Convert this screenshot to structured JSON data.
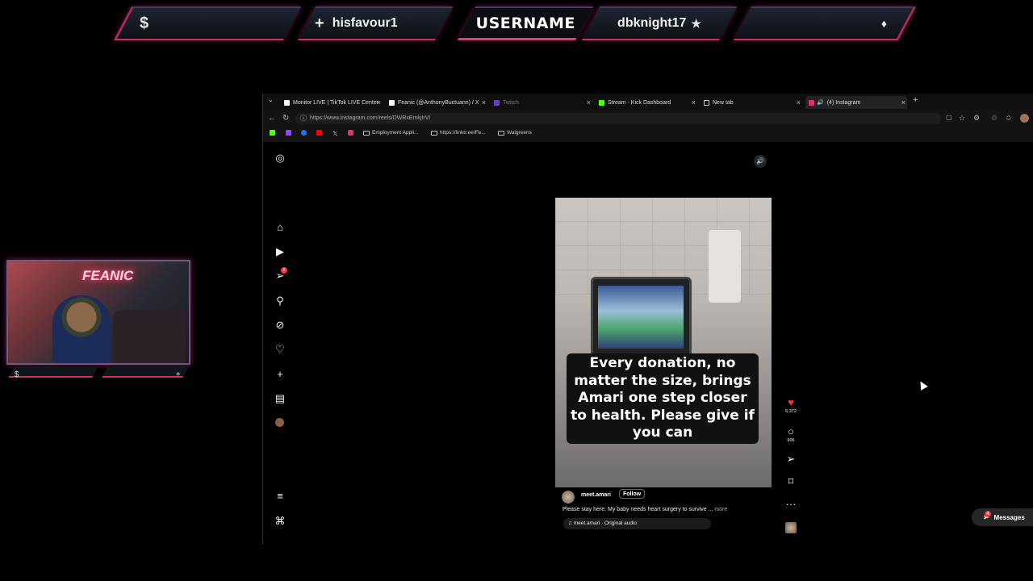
{
  "overlay": {
    "left_icon": "$",
    "follower_icon": "+",
    "follower": "hisfavour1",
    "title": "USERNAME",
    "subscriber": "dbknight17",
    "subscriber_icon": "★",
    "right_icon": "♦"
  },
  "webcam": {
    "neon_sign": "FEANIC",
    "left_icon": "$",
    "right_icon": "+"
  },
  "browser": {
    "tabs": [
      {
        "label": "Monitor LIVE | TikTok LIVE Center",
        "favicon_color": "#ffffff"
      },
      {
        "label": "Feanic (@AnthonyBuctuann) / X",
        "favicon_color": "#ffffff"
      },
      {
        "label": "Twitch",
        "favicon_color": "#9146ff"
      },
      {
        "label": "Stream - Kick Dashboard",
        "favicon_color": "#53fc18"
      },
      {
        "label": "New tab",
        "favicon_color": "#cccccc"
      },
      {
        "label": "(4) Instagram",
        "favicon_color": "#e1306c"
      }
    ],
    "url": "https://www.instagram.com/reels/DWRxEmkjtrV/",
    "bookmarks": [
      "Employment Appli...",
      "https://linktr.ee/Fe...",
      "Walgreens"
    ]
  },
  "instagram": {
    "sidebar_badge": "6",
    "reel": {
      "caption": "Every donation, no matter the size, brings Amari one step closer to health. Please give if you can",
      "username": "meet.amari",
      "follow_label": "Follow",
      "description": "Please stay here. My baby needs heart surgery to survive ...",
      "more_label": "more",
      "audio": "meet.amari · Original audio"
    },
    "actions": {
      "likes": "6,372",
      "comments": "906"
    },
    "messages": {
      "label": "Messages",
      "badge": "4"
    }
  },
  "colors": {
    "accent_pink": "#c8335f",
    "like_red": "#ff3040"
  }
}
